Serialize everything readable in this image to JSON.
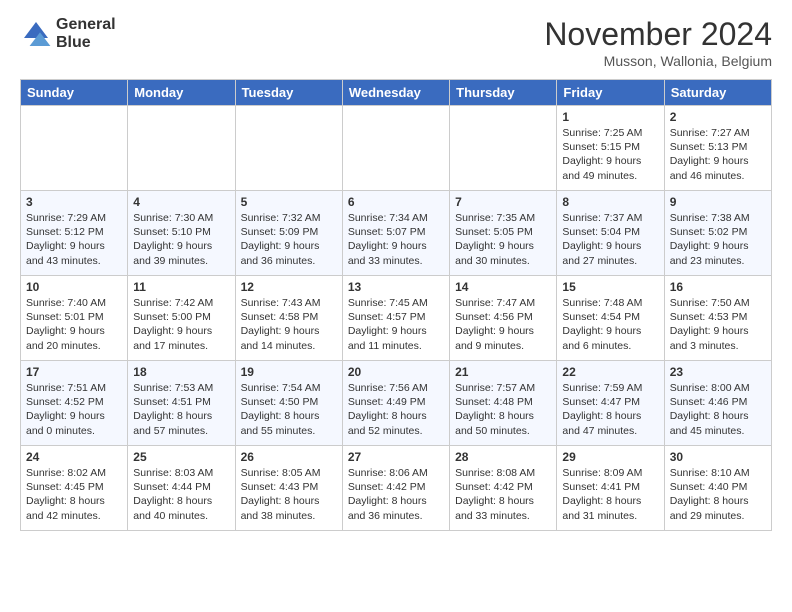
{
  "header": {
    "title": "November 2024",
    "location": "Musson, Wallonia, Belgium",
    "logo_line1": "General",
    "logo_line2": "Blue"
  },
  "days_of_week": [
    "Sunday",
    "Monday",
    "Tuesday",
    "Wednesday",
    "Thursday",
    "Friday",
    "Saturday"
  ],
  "weeks": [
    [
      {
        "day": "",
        "data": ""
      },
      {
        "day": "",
        "data": ""
      },
      {
        "day": "",
        "data": ""
      },
      {
        "day": "",
        "data": ""
      },
      {
        "day": "",
        "data": ""
      },
      {
        "day": "1",
        "data": "Sunrise: 7:25 AM\nSunset: 5:15 PM\nDaylight: 9 hours and 49 minutes."
      },
      {
        "day": "2",
        "data": "Sunrise: 7:27 AM\nSunset: 5:13 PM\nDaylight: 9 hours and 46 minutes."
      }
    ],
    [
      {
        "day": "3",
        "data": "Sunrise: 7:29 AM\nSunset: 5:12 PM\nDaylight: 9 hours and 43 minutes."
      },
      {
        "day": "4",
        "data": "Sunrise: 7:30 AM\nSunset: 5:10 PM\nDaylight: 9 hours and 39 minutes."
      },
      {
        "day": "5",
        "data": "Sunrise: 7:32 AM\nSunset: 5:09 PM\nDaylight: 9 hours and 36 minutes."
      },
      {
        "day": "6",
        "data": "Sunrise: 7:34 AM\nSunset: 5:07 PM\nDaylight: 9 hours and 33 minutes."
      },
      {
        "day": "7",
        "data": "Sunrise: 7:35 AM\nSunset: 5:05 PM\nDaylight: 9 hours and 30 minutes."
      },
      {
        "day": "8",
        "data": "Sunrise: 7:37 AM\nSunset: 5:04 PM\nDaylight: 9 hours and 27 minutes."
      },
      {
        "day": "9",
        "data": "Sunrise: 7:38 AM\nSunset: 5:02 PM\nDaylight: 9 hours and 23 minutes."
      }
    ],
    [
      {
        "day": "10",
        "data": "Sunrise: 7:40 AM\nSunset: 5:01 PM\nDaylight: 9 hours and 20 minutes."
      },
      {
        "day": "11",
        "data": "Sunrise: 7:42 AM\nSunset: 5:00 PM\nDaylight: 9 hours and 17 minutes."
      },
      {
        "day": "12",
        "data": "Sunrise: 7:43 AM\nSunset: 4:58 PM\nDaylight: 9 hours and 14 minutes."
      },
      {
        "day": "13",
        "data": "Sunrise: 7:45 AM\nSunset: 4:57 PM\nDaylight: 9 hours and 11 minutes."
      },
      {
        "day": "14",
        "data": "Sunrise: 7:47 AM\nSunset: 4:56 PM\nDaylight: 9 hours and 9 minutes."
      },
      {
        "day": "15",
        "data": "Sunrise: 7:48 AM\nSunset: 4:54 PM\nDaylight: 9 hours and 6 minutes."
      },
      {
        "day": "16",
        "data": "Sunrise: 7:50 AM\nSunset: 4:53 PM\nDaylight: 9 hours and 3 minutes."
      }
    ],
    [
      {
        "day": "17",
        "data": "Sunrise: 7:51 AM\nSunset: 4:52 PM\nDaylight: 9 hours and 0 minutes."
      },
      {
        "day": "18",
        "data": "Sunrise: 7:53 AM\nSunset: 4:51 PM\nDaylight: 8 hours and 57 minutes."
      },
      {
        "day": "19",
        "data": "Sunrise: 7:54 AM\nSunset: 4:50 PM\nDaylight: 8 hours and 55 minutes."
      },
      {
        "day": "20",
        "data": "Sunrise: 7:56 AM\nSunset: 4:49 PM\nDaylight: 8 hours and 52 minutes."
      },
      {
        "day": "21",
        "data": "Sunrise: 7:57 AM\nSunset: 4:48 PM\nDaylight: 8 hours and 50 minutes."
      },
      {
        "day": "22",
        "data": "Sunrise: 7:59 AM\nSunset: 4:47 PM\nDaylight: 8 hours and 47 minutes."
      },
      {
        "day": "23",
        "data": "Sunrise: 8:00 AM\nSunset: 4:46 PM\nDaylight: 8 hours and 45 minutes."
      }
    ],
    [
      {
        "day": "24",
        "data": "Sunrise: 8:02 AM\nSunset: 4:45 PM\nDaylight: 8 hours and 42 minutes."
      },
      {
        "day": "25",
        "data": "Sunrise: 8:03 AM\nSunset: 4:44 PM\nDaylight: 8 hours and 40 minutes."
      },
      {
        "day": "26",
        "data": "Sunrise: 8:05 AM\nSunset: 4:43 PM\nDaylight: 8 hours and 38 minutes."
      },
      {
        "day": "27",
        "data": "Sunrise: 8:06 AM\nSunset: 4:42 PM\nDaylight: 8 hours and 36 minutes."
      },
      {
        "day": "28",
        "data": "Sunrise: 8:08 AM\nSunset: 4:42 PM\nDaylight: 8 hours and 33 minutes."
      },
      {
        "day": "29",
        "data": "Sunrise: 8:09 AM\nSunset: 4:41 PM\nDaylight: 8 hours and 31 minutes."
      },
      {
        "day": "30",
        "data": "Sunrise: 8:10 AM\nSunset: 4:40 PM\nDaylight: 8 hours and 29 minutes."
      }
    ]
  ]
}
